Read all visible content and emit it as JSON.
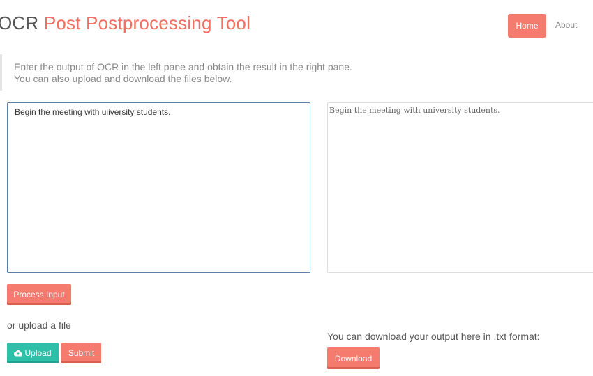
{
  "header": {
    "title_prefix": "OCR ",
    "title_main": "Post Postprocessing Tool",
    "nav": {
      "home": "Home",
      "about": "About"
    }
  },
  "intro": {
    "line1": "Enter the output of OCR in the left pane and obtain the result in the right pane.",
    "line2": "You can also upload and download the files below."
  },
  "input_pane": {
    "value": "Begin the meeting with uiiversity students."
  },
  "output_pane": {
    "value": "Begin the meeting with university students."
  },
  "actions": {
    "process_label": "Process Input",
    "upload_prompt": "or upload a file",
    "upload_label": "Upload",
    "submit_label": "Submit",
    "download_prompt": "You can download your output here in .txt format:",
    "download_label": "Download"
  },
  "colors": {
    "accent": "#f47b6d",
    "teal": "#2dbfa8"
  }
}
